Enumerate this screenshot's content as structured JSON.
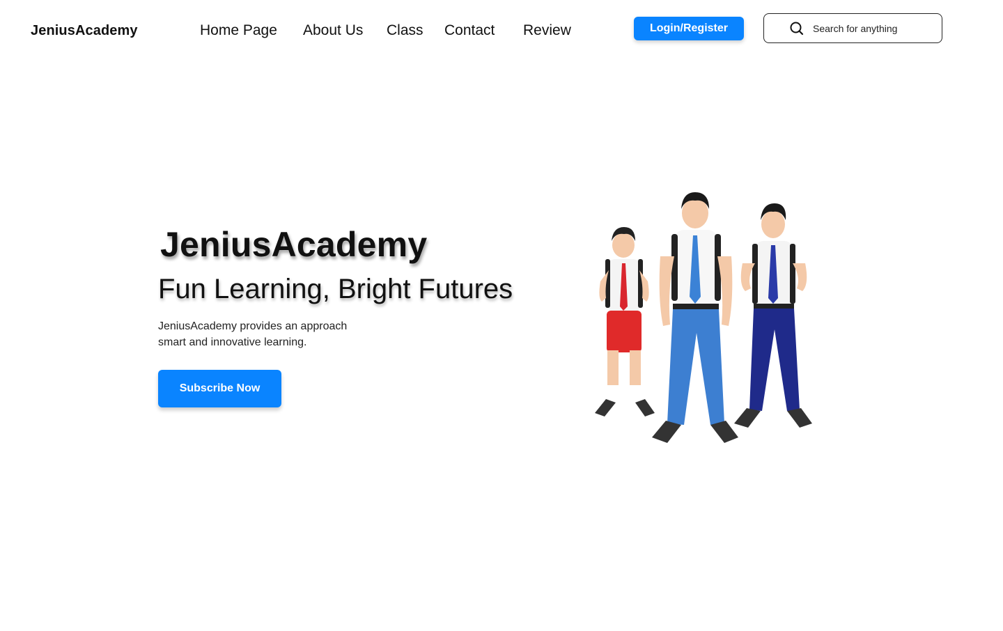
{
  "header": {
    "logo": "JeniusAcademy",
    "nav": [
      {
        "label": "Home Page"
      },
      {
        "label": "About Us"
      },
      {
        "label": "Class"
      },
      {
        "label": "Contact"
      },
      {
        "label": "Review"
      }
    ],
    "login_label": "Login/Register",
    "search": {
      "placeholder": "Search for anything",
      "icon": "search-icon"
    }
  },
  "hero": {
    "title": "JeniusAcademy",
    "subtitle": "Fun Learning, Bright Futures",
    "description_lines": [
      "JeniusAcademy provides an approach",
      "smart and innovative learning."
    ],
    "cta_label": "Subscribe Now",
    "illustration": "three-students-icon"
  },
  "colors": {
    "accent": "#0a84ff",
    "text": "#111111",
    "background": "#ffffff"
  }
}
